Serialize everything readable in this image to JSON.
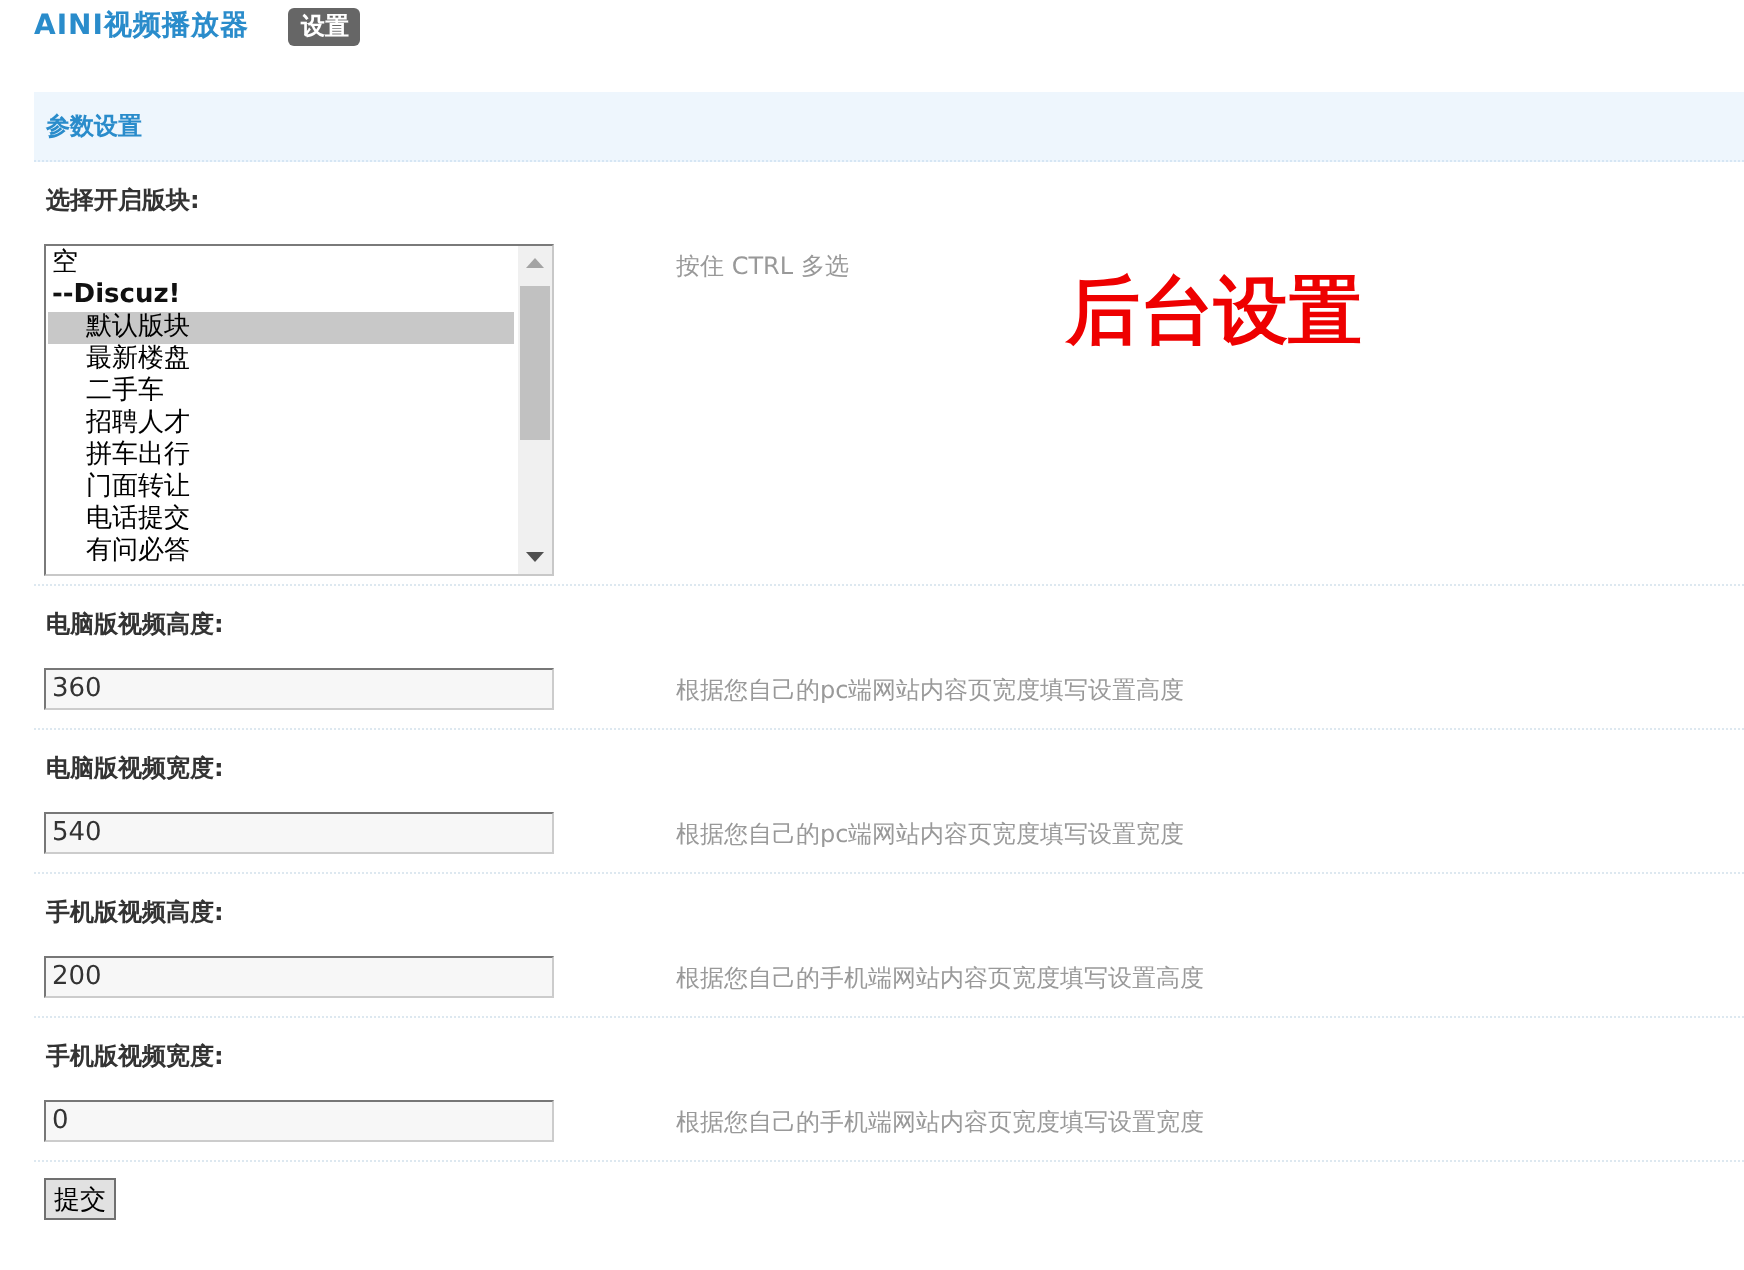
{
  "header": {
    "title": "AINI视频播放器",
    "tabs": [
      {
        "label": "设置",
        "selected": true
      }
    ]
  },
  "section": {
    "title": "参数设置"
  },
  "settings": [
    {
      "kind": "multiselect",
      "label": "选择开启版块:",
      "options": [
        {
          "label": "空",
          "selected": false
        },
        {
          "label": "--Discuz!",
          "children": [
            {
              "label": "默认版块",
              "selected": true
            },
            {
              "label": "最新楼盘",
              "selected": false
            },
            {
              "label": "二手车",
              "selected": false
            },
            {
              "label": "招聘人才",
              "selected": false
            },
            {
              "label": "拼车出行",
              "selected": false
            },
            {
              "label": "门面转让",
              "selected": false
            },
            {
              "label": "电话提交",
              "selected": false
            },
            {
              "label": "有问必答",
              "selected": false
            }
          ]
        }
      ],
      "hint": "按住 CTRL 多选"
    },
    {
      "kind": "text",
      "label": "电脑版视频高度:",
      "value": "360",
      "hint": "根据您自己的pc端网站内容页宽度填写设置高度"
    },
    {
      "kind": "text",
      "label": "电脑版视频宽度:",
      "value": "540",
      "hint": "根据您自己的pc端网站内容页宽度填写设置宽度"
    },
    {
      "kind": "text",
      "label": "手机版视频高度:",
      "value": "200",
      "hint": "根据您自己的手机端网站内容页宽度填写设置高度"
    },
    {
      "kind": "text",
      "label": "手机版视频宽度:",
      "value": "0",
      "hint": "根据您自己的手机端网站内容页宽度填写设置宽度"
    }
  ],
  "annotation": {
    "text": "后台设置"
  },
  "submit_button": "提交"
}
